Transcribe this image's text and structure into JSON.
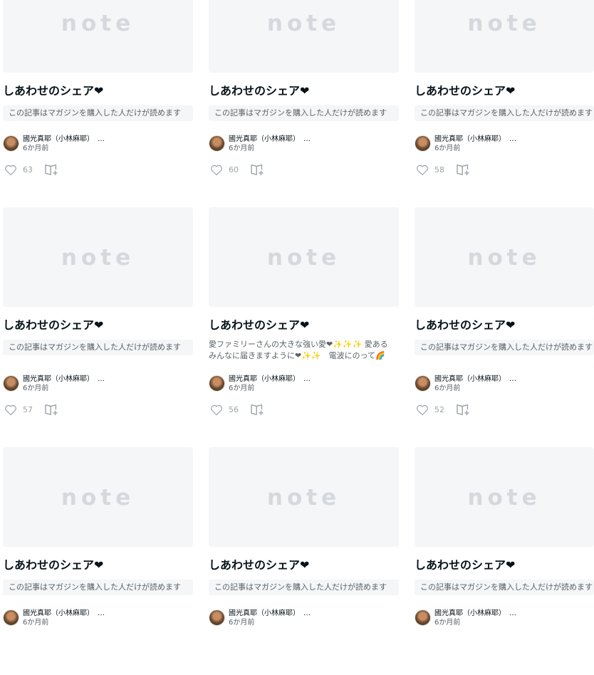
{
  "logo_text": "note",
  "cards": [
    {
      "title": "しあわせのシェア❤",
      "paid_notice": "この記事はマガジンを購入した人だけが読めます",
      "excerpt": "",
      "author": "國光真耶（小林麻耶）　…",
      "time": "6か月前",
      "likes": "63"
    },
    {
      "title": "しあわせのシェア❤",
      "paid_notice": "この記事はマガジンを購入した人だけが読めます",
      "excerpt": "",
      "author": "國光真耶（小林麻耶）　…",
      "time": "6か月前",
      "likes": "60"
    },
    {
      "title": "しあわせのシェア❤",
      "paid_notice": "この記事はマガジンを購入した人だけが読めます",
      "excerpt": "",
      "author": "國光真耶（小林麻耶）　…",
      "time": "6か月前",
      "likes": "58"
    },
    {
      "title": "しあわせのシェア❤",
      "paid_notice": "この記事はマガジンを購入した人だけが読めます",
      "excerpt": "",
      "author": "國光真耶（小林麻耶）　…",
      "time": "6か月前",
      "likes": "57"
    },
    {
      "title": "しあわせのシェア❤",
      "paid_notice": "",
      "excerpt": "愛ファミリーさんの大きな強い愛❤✨✨✨ 愛あるみんなに届きますように❤✨✨　電波にのって🌈 地…",
      "author": "國光真耶（小林麻耶）　…",
      "time": "6か月前",
      "likes": "56"
    },
    {
      "title": "しあわせのシェア❤",
      "paid_notice": "この記事はマガジンを購入した人だけが読めます",
      "excerpt": "",
      "author": "國光真耶（小林麻耶）　…",
      "time": "6か月前",
      "likes": "52"
    },
    {
      "title": "しあわせのシェア❤",
      "paid_notice": "この記事はマガジンを購入した人だけが読めます",
      "excerpt": "",
      "author": "國光真耶（小林麻耶）　…",
      "time": "6か月前",
      "likes": ""
    },
    {
      "title": "しあわせのシェア❤",
      "paid_notice": "この記事はマガジンを購入した人だけが読めます",
      "excerpt": "",
      "author": "國光真耶（小林麻耶）　…",
      "time": "6か月前",
      "likes": ""
    },
    {
      "title": "しあわせのシェア❤",
      "paid_notice": "この記事はマガジンを購入した人だけが読めます",
      "excerpt": "",
      "author": "國光真耶（小林麻耶）　…",
      "time": "6か月前",
      "likes": ""
    }
  ],
  "icons": {
    "like": "heart-icon",
    "save": "magazine-add-icon",
    "avatar": "author-avatar"
  },
  "colors": {
    "thumb_bg": "#f4f6f8",
    "logo": "#d5d9dd",
    "meta_text": "#9ba3a8"
  }
}
